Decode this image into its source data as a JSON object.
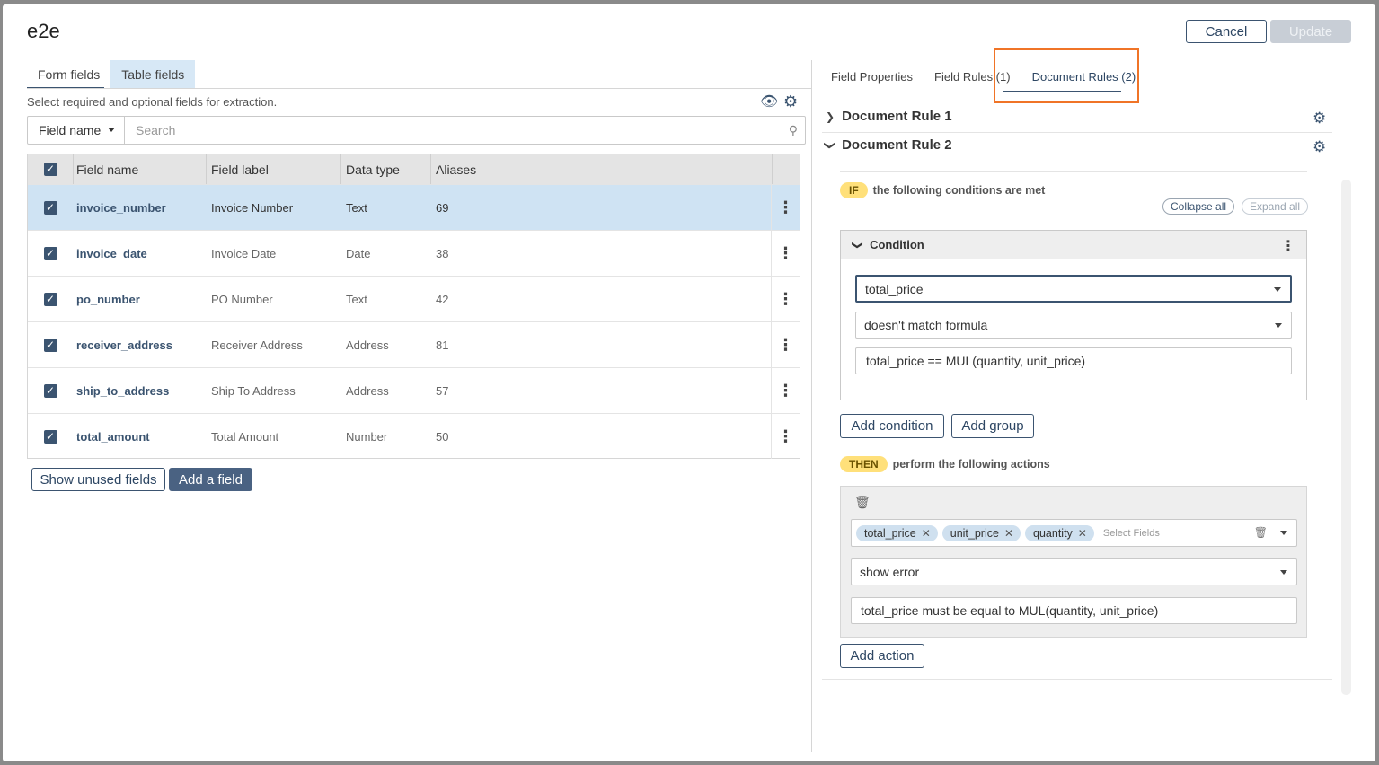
{
  "modal": {
    "title": "e2e",
    "cancel_label": "Cancel",
    "update_label": "Update"
  },
  "left": {
    "tabs": [
      {
        "label": "Form fields"
      },
      {
        "label": "Table fields"
      }
    ],
    "hint": "Select required and optional fields for extraction.",
    "search": {
      "select_value": "Field name",
      "placeholder": "Search"
    },
    "columns": [
      "Field name",
      "Field label",
      "Data type",
      "Aliases"
    ],
    "rows": [
      {
        "name": "invoice_number",
        "label": "Invoice Number",
        "type": "Text",
        "aliases": "69"
      },
      {
        "name": "invoice_date",
        "label": "Invoice Date",
        "type": "Date",
        "aliases": "38"
      },
      {
        "name": "po_number",
        "label": "PO Number",
        "type": "Text",
        "aliases": "42"
      },
      {
        "name": "receiver_address",
        "label": "Receiver Address",
        "type": "Address",
        "aliases": "81"
      },
      {
        "name": "ship_to_address",
        "label": "Ship To Address",
        "type": "Address",
        "aliases": "57"
      },
      {
        "name": "total_amount",
        "label": "Total Amount",
        "type": "Number",
        "aliases": "50"
      }
    ],
    "show_unused_label": "Show unused fields",
    "add_field_label": "Add a field",
    "icons": {
      "eye": "eye-icon",
      "gear": "gear-icon",
      "search": "search-icon",
      "menu": "kebab-menu-icon"
    }
  },
  "right": {
    "tabs": [
      {
        "label": "Field Properties"
      },
      {
        "label": "Field Rules (1)"
      },
      {
        "label": "Document Rules (2)"
      }
    ],
    "rule1_title": "Document Rule 1",
    "rule2_title": "Document Rule 2",
    "if_pill": "IF",
    "if_text": "the following conditions are met",
    "collapse_all": "Collapse all",
    "expand_all": "Expand all",
    "condition_title": "Condition",
    "condition_field": "total_price",
    "condition_operator": "doesn't match formula",
    "condition_formula": "total_price == MUL(quantity, unit_price)",
    "add_condition": "Add condition",
    "add_group": "Add group",
    "then_pill": "THEN",
    "then_text": "perform the following actions",
    "action_chips": [
      "total_price",
      "unit_price",
      "quantity"
    ],
    "action_fields_placeholder": "Select Fields",
    "action_type": "show error",
    "action_message": "total_price must be equal to MUL(quantity, unit_price)",
    "add_action": "Add action"
  },
  "colors": {
    "accent": "#3b5470",
    "selected_row": "#cfe3f3",
    "pill": "#ffe07a",
    "highlight": "#f07427"
  }
}
